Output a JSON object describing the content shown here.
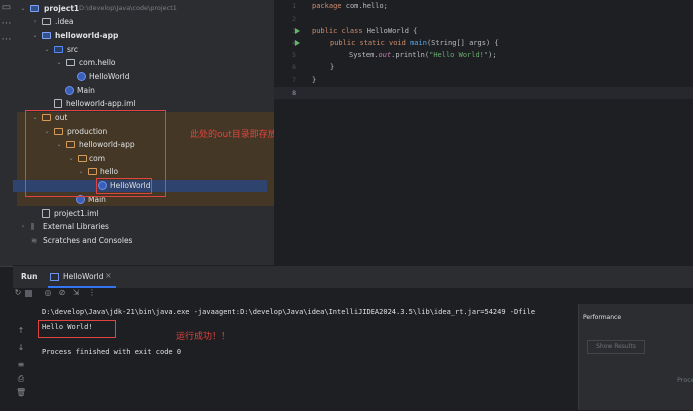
{
  "project_tree": {
    "project_name": "project1",
    "project_path": "D:\\develop\\Java\\code\\project1",
    "idea_folder": ".idea",
    "module_name": "helloworld-app",
    "src_folder": "src",
    "package_name": "com.hello",
    "class_helloworld": "HelloWorld",
    "class_main": "Main",
    "module_iml": "helloworld-app.iml",
    "out_folder": "out",
    "production_folder": "production",
    "out_module_folder": "helloworld-app",
    "com_folder": "com",
    "hello_folder": "hello",
    "out_class_helloworld": "HelloWorld",
    "out_class_main": "Main",
    "project_iml": "project1.iml",
    "external_libraries": "External Libraries",
    "scratches": "Scratches and Consoles"
  },
  "annotations": {
    "out_note": "此处的out目录即存放编译后的class文件",
    "run_note": "运行成功！！"
  },
  "editor": {
    "line_numbers": [
      "1",
      "2",
      "3",
      "4",
      "5",
      "6",
      "7",
      "8"
    ],
    "line1_kw": "package",
    "line1_rest": " com.hello;",
    "line3_kw": "public class",
    "line3_rest": " HelloWorld {",
    "line4_kw": "public static void",
    "line4_fn": "main",
    "line4_rest": "(String[] args) {",
    "line5_a": "System.",
    "line5_out": "out",
    "line5_b": ".println(",
    "line5_str": "\"Hello World!\"",
    "line5_c": ");",
    "line6": "}",
    "line7": "}"
  },
  "run_panel": {
    "run_label": "Run",
    "tab_label": "HelloWorld",
    "tab_close": "×",
    "command_line": "D:\\develop\\Java\\jdk-21\\bin\\java.exe -javaagent:D:\\develop\\Java\\idea\\IntelliJIDEA2024.3.5\\lib\\idea_rt.jar=54249 -Dfile",
    "output_line": "Hello World!",
    "exit_line": "Process finished with exit code 0"
  },
  "performance": {
    "title": "Performance",
    "show_results": "Show Results",
    "proc_label": "Proce"
  },
  "colors": {
    "accent_red": "#e0443e",
    "run_green": "#5fb865",
    "selection": "#2e436e"
  }
}
